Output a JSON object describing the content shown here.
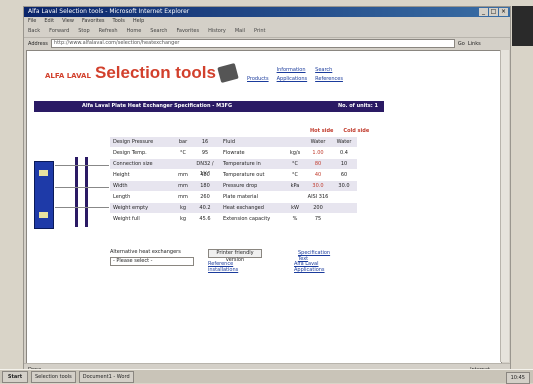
{
  "window": {
    "title": "Alfa Laval Selection tools - Microsoft Internet Explorer",
    "controls": [
      "_",
      "□",
      "×"
    ]
  },
  "menu": [
    "File",
    "Edit",
    "View",
    "Favorites",
    "Tools",
    "Help"
  ],
  "toolbar": [
    "Back",
    "Forward",
    "Stop",
    "Refresh",
    "Home",
    "Search",
    "Favorites",
    "History",
    "Mail",
    "Print"
  ],
  "address": {
    "label": "Address",
    "value": "http://www.alfalaval.com/selection/heatexchanger",
    "go": "Go",
    "links": "Links"
  },
  "page": {
    "logo": "ALFA LAVAL",
    "app_title": "Selection tools",
    "top_links": [
      "Information",
      "Search",
      "Products",
      "Applications",
      "References"
    ],
    "bar_title": "Alfa Laval Plate Heat Exchanger Specification - M3FG",
    "bar_right": "No. of units: 1",
    "col_heads": [
      "Hot side",
      "Cold side"
    ],
    "rows": [
      {
        "label": "Design Pressure",
        "unit": "bar",
        "value": "16",
        "label2": "Fluid",
        "unit2": "",
        "hot": "Water",
        "cold": "Water"
      },
      {
        "label": "Design Temp.",
        "unit": "°C",
        "value": "95",
        "label2": "Flowrate",
        "unit2": "kg/s",
        "hot": "1.00",
        "cold": "0.4"
      },
      {
        "label": "Connection size",
        "unit": "",
        "value": "DN32 / 1¼\"",
        "label2": "Temperature in",
        "unit2": "°C",
        "hot": "80",
        "cold": "10"
      },
      {
        "label": "Height",
        "unit": "mm",
        "value": "480",
        "label2": "Temperature out",
        "unit2": "°C",
        "hot": "40",
        "cold": "60"
      },
      {
        "label": "Width",
        "unit": "mm",
        "value": "180",
        "label2": "Pressure drop",
        "unit2": "kPa",
        "hot": "30.0",
        "cold": "30.0"
      },
      {
        "label": "Length",
        "unit": "mm",
        "value": "260",
        "label2": "Plate material",
        "unit2": "",
        "hot": "AISI 316",
        "cold": ""
      },
      {
        "label": "Weight empty",
        "unit": "kg",
        "value": "40.2",
        "label2": "Heat exchanged",
        "unit2": "kW",
        "hot": "200",
        "cold": ""
      },
      {
        "label": "Weight full",
        "unit": "kg",
        "value": "45.6",
        "label2": "Extension capacity",
        "unit2": "%",
        "hot": "75",
        "cold": ""
      }
    ],
    "bottom": {
      "select_label": "Alternative heat exchangers",
      "select_value": "- Please select -",
      "print_button": "Printer friendly version",
      "link_reference": "Reference installations",
      "link_spec": "Specification Text",
      "link_applications": "Alfa Laval Applications"
    }
  },
  "status": {
    "text": "Done",
    "zone": "Internet"
  },
  "taskbar": {
    "start": "Start",
    "tasks": [
      "Selection tools",
      "Document1 - Word"
    ],
    "time": "10:45"
  },
  "colors": {
    "accent": "#d2402c",
    "bar": "#2a1a64",
    "link": "#1a3b9c",
    "value_red": "#c0392b"
  }
}
